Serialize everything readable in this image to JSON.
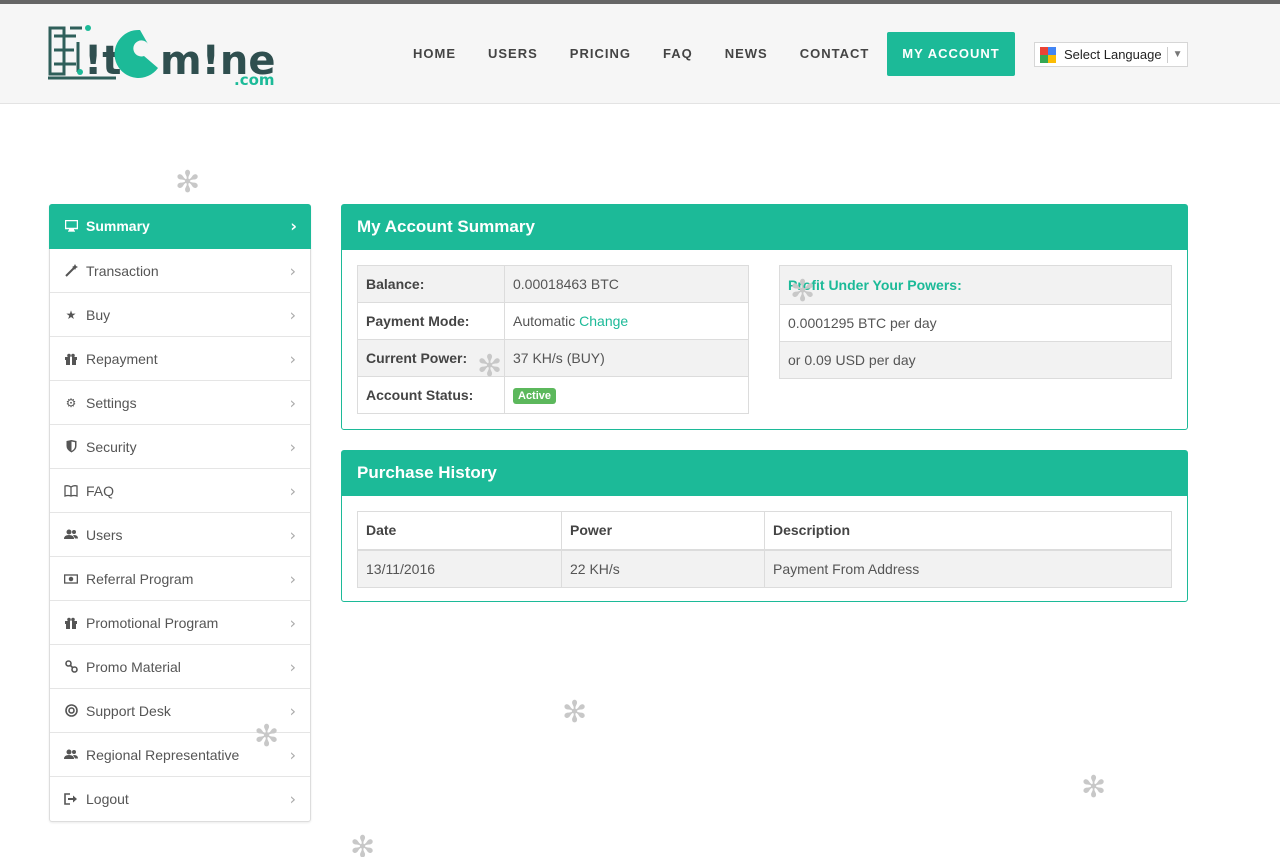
{
  "brand": {
    "logo_text": "BitcMiner",
    "logo_suffix": ".com"
  },
  "nav": {
    "items": [
      {
        "label": "HOME"
      },
      {
        "label": "USERS"
      },
      {
        "label": "PRICING"
      },
      {
        "label": "FAQ"
      },
      {
        "label": "NEWS"
      },
      {
        "label": "CONTACT"
      },
      {
        "label": "MY ACCOUNT",
        "active": true
      }
    ]
  },
  "language": {
    "label": "Select Language",
    "arrow": "▼"
  },
  "sidebar": {
    "items": [
      {
        "label": "Summary",
        "icon": "monitor-icon",
        "active": true
      },
      {
        "label": "Transaction",
        "icon": "magic-wand-icon"
      },
      {
        "label": "Buy",
        "icon": "star-icon"
      },
      {
        "label": "Repayment",
        "icon": "gift-icon"
      },
      {
        "label": "Settings",
        "icon": "gears-icon"
      },
      {
        "label": "Security",
        "icon": "shield-icon"
      },
      {
        "label": "FAQ",
        "icon": "book-icon"
      },
      {
        "label": "Users",
        "icon": "users-icon"
      },
      {
        "label": "Referral Program",
        "icon": "money-icon"
      },
      {
        "label": "Promotional Program",
        "icon": "gift-icon"
      },
      {
        "label": "Promo Material",
        "icon": "link-icon"
      },
      {
        "label": "Support Desk",
        "icon": "lifebuoy-icon"
      },
      {
        "label": "Regional Representative",
        "icon": "users-icon"
      },
      {
        "label": "Logout",
        "icon": "sign-out-icon"
      }
    ]
  },
  "summary": {
    "title": "My Account Summary",
    "balance_label": "Balance:",
    "balance_value": "0.00018463 BTC",
    "payment_mode_label": "Payment Mode:",
    "payment_mode_value": "Automatic",
    "payment_mode_link": "Change",
    "current_power_label": "Current Power:",
    "current_power_value": "37 KH/s (BUY)",
    "account_status_label": "Account Status:",
    "account_status_value": "Active",
    "profit_header": "Profit Under Your Powers:",
    "profit_btc": "0.0001295 BTC per day",
    "profit_usd": "or 0.09 USD per day"
  },
  "history": {
    "title": "Purchase History",
    "columns": [
      "Date",
      "Power",
      "Description"
    ],
    "rows": [
      {
        "date": "13/11/2016",
        "power": "22 KH/s",
        "description": "Payment From Address"
      }
    ]
  },
  "colors": {
    "accent": "#1cba98",
    "badge_active": "#5cb85c"
  }
}
